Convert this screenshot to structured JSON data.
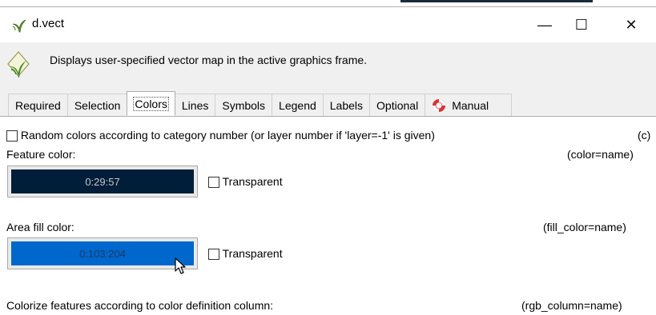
{
  "window": {
    "title": "d.vect",
    "minimize_glyph": "—",
    "maximize_glyph": "☐",
    "close_glyph": "✕"
  },
  "description": "Displays user-specified vector map in the active graphics frame.",
  "tabs": [
    {
      "label": "Required"
    },
    {
      "label": "Selection"
    },
    {
      "label": "Colors",
      "active": true
    },
    {
      "label": "Lines"
    },
    {
      "label": "Symbols"
    },
    {
      "label": "Legend"
    },
    {
      "label": "Labels"
    },
    {
      "label": "Optional"
    },
    {
      "label": "Manual",
      "icon": "lifebuoy-icon"
    }
  ],
  "colors_panel": {
    "random_colors": {
      "label": "Random colors according to category number (or layer number if  'layer=-1' is given)",
      "flag": "(c)",
      "checked": false
    },
    "feature_color": {
      "label": "Feature color:",
      "param": "(color=name)",
      "value": "0:29:57",
      "swatch_color": "#001d39",
      "text_color": "#c8c8c8",
      "transparent_label": "Transparent",
      "transparent_checked": false
    },
    "area_fill_color": {
      "label": "Area fill color:",
      "param": "(fill_color=name)",
      "value": "0:103:204",
      "swatch_color": "#0067cc",
      "text_color": "#1a3a6a",
      "transparent_label": "Transparent",
      "transparent_checked": false
    },
    "rgb_column": {
      "label": "Colorize features according to color definition column:",
      "param": "(rgb_column=name)"
    }
  }
}
